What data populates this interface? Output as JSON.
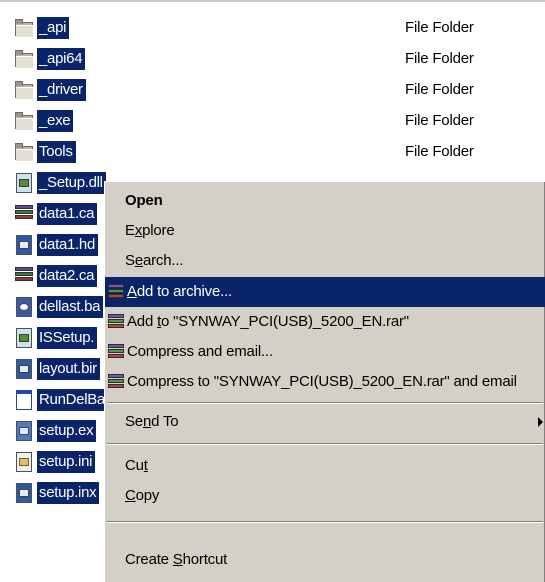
{
  "files": [
    {
      "name": "_api",
      "type": "File Folder",
      "icon": "folder-icon"
    },
    {
      "name": "_api64",
      "type": "File Folder",
      "icon": "folder-icon"
    },
    {
      "name": "_driver",
      "type": "File Folder",
      "icon": "folder-icon"
    },
    {
      "name": "_exe",
      "type": "File Folder",
      "icon": "folder-icon"
    },
    {
      "name": "Tools",
      "type": "File Folder",
      "icon": "folder-icon"
    },
    {
      "name": "_Setup.dll",
      "type": "",
      "icon": "dll-file-icon"
    },
    {
      "name": "data1.ca",
      "type": "",
      "icon": "cab-archive-icon"
    },
    {
      "name": "data1.hd",
      "type": "",
      "icon": "hdr-file-icon"
    },
    {
      "name": "data2.ca",
      "type": "",
      "icon": "cab-archive-icon"
    },
    {
      "name": "dellast.ba",
      "type": "",
      "icon": "config-file-icon"
    },
    {
      "name": "ISSetup.",
      "type": "",
      "icon": "dll-file-icon"
    },
    {
      "name": "layout.bir",
      "type": "",
      "icon": "bin-file-icon"
    },
    {
      "name": "RunDelBa",
      "type": "",
      "icon": "exe-window-icon"
    },
    {
      "name": "setup.ex",
      "type": "",
      "icon": "setup-exe-icon"
    },
    {
      "name": "setup.ini",
      "type": "",
      "icon": "ini-file-icon"
    },
    {
      "name": "setup.inx",
      "type": "",
      "icon": "inx-file-icon"
    }
  ],
  "context_menu": {
    "open": "Open",
    "explore_pre": "E",
    "explore_u": "x",
    "explore_post": "plore",
    "search_pre": "S",
    "search_u": "e",
    "search_post": "arch...",
    "add_archive_pre": "",
    "add_archive_u": "A",
    "add_archive_post": "dd to archive...",
    "add_to_rar_pre": "Add ",
    "add_to_rar_u": "t",
    "add_to_rar_post": "o \"SYNWAY_PCI(USB)_5200_EN.rar\"",
    "compress_email": "Compress and email...",
    "compress_to_email": "Compress to \"SYNWAY_PCI(USB)_5200_EN.rar\" and email",
    "send_to_pre": "Se",
    "send_to_u": "n",
    "send_to_post": "d To",
    "cut_pre": "Cu",
    "cut_u": "t",
    "cut_post": "",
    "copy_pre": "",
    "copy_u": "C",
    "copy_post": "opy",
    "shortcut_pre": "Create ",
    "shortcut_u": "S",
    "shortcut_post": "hortcut"
  },
  "colors": {
    "selection": "#0a246a",
    "menu_bg": "#d4d0c8"
  }
}
